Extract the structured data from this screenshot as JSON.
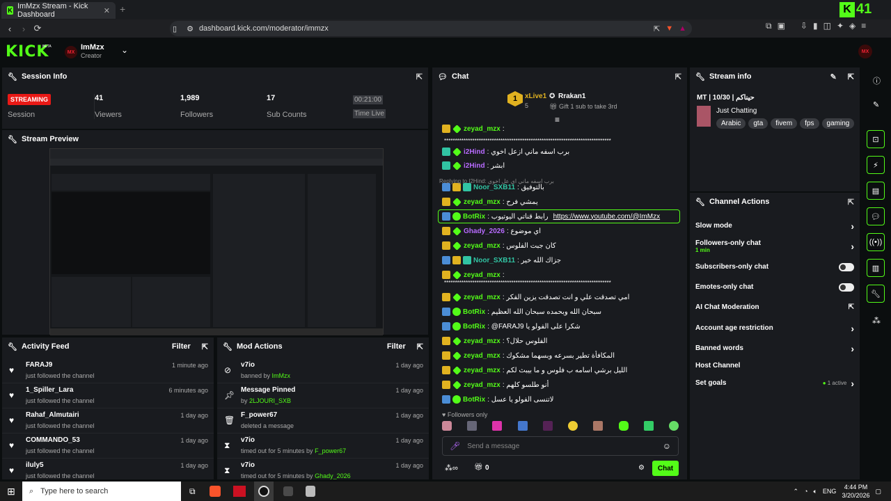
{
  "browser": {
    "tab_title": "ImMzx Stream - Kick Dashboard",
    "url": "dashboard.kick.com/moderator/immzx",
    "ext_badge": "41"
  },
  "header": {
    "logo": "KICK",
    "beta": "BETA",
    "channel": "ImMzx",
    "role": "Creator",
    "avatar": "MX"
  },
  "session": {
    "title": "Session Info",
    "status": "STREAMING",
    "status_label": "Session",
    "viewers": "41",
    "viewers_label": "Viewers",
    "followers": "1,989",
    "followers_label": "Followers",
    "subs": "17",
    "subs_label": "Sub Counts",
    "time": "00:21:00",
    "time_label": "Time Live"
  },
  "preview": {
    "title": "Stream Preview"
  },
  "activity": {
    "title": "Activity Feed",
    "filter": "Filter",
    "items": [
      {
        "name": "FARAJ9",
        "sub": "just followed the channel",
        "time": "1 minute ago"
      },
      {
        "name": "1_Spiller_Lara",
        "sub": "just followed the channel",
        "time": "6 minutes ago"
      },
      {
        "name": "Rahaf_Almutairi",
        "sub": "just followed the channel",
        "time": "1 day ago"
      },
      {
        "name": "COMMANDO_53",
        "sub": "just followed the channel",
        "time": "1 day ago"
      },
      {
        "name": "iluly5",
        "sub": "just followed the channel",
        "time": "1 day ago"
      }
    ]
  },
  "mod": {
    "title": "Mod Actions",
    "filter": "Filter",
    "items": [
      {
        "name": "v7io",
        "pre": "banned by ",
        "by": "ImMzx",
        "time": "1 day ago"
      },
      {
        "name": "Message Pinned",
        "pre": "by ",
        "by": "2LJOURI_SXB",
        "time": "1 day ago"
      },
      {
        "name": "F_power67",
        "pre": "deleted a message",
        "by": "",
        "time": "1 day ago"
      },
      {
        "name": "v7io",
        "pre": "timed out for 5 minutes by ",
        "by": "F_power67",
        "time": "1 day ago"
      },
      {
        "name": "v7io",
        "pre": "timed out for 5 minutes by ",
        "by": "Ghady_2026",
        "time": "1 day ago"
      }
    ]
  },
  "chat": {
    "title": "Chat",
    "top1_name": "xLive1",
    "top1_count": "5",
    "top2_name": "Rrakan1",
    "gift": "Gift 1 sub to take 3rd",
    "reply": "Replying to I2Hind: برب اسفه ماني اي عل اخوي",
    "lines": [
      {
        "b": "crown gem",
        "name": "zeyad_mzx",
        "c": "#53fc18",
        "msg": ":"
      },
      {
        "b": "",
        "name": "",
        "c": "#fff",
        "msg": "*****************************************************************************"
      },
      {
        "b": "sub gem",
        "name": "i2Hind",
        "c": "#b86bff",
        "msg": ": برب اسفه ماني ازعل اخوي"
      },
      {
        "b": "sub gem",
        "name": "i2Hind",
        "c": "#b86bff",
        "msg": ": ابشر"
      },
      {
        "b": "mod crown sub",
        "name": "Noor_SXB11",
        "c": "#31c4a3",
        "msg": ": بالتوفيق"
      },
      {
        "b": "crown gem",
        "name": "zeyad_mzx",
        "c": "#53fc18",
        "msg": ": يمشي فرح"
      },
      {
        "b": "mod bot",
        "name": "BotRix",
        "c": "#53fc18",
        "msg": ": رابط قناتي اليوتيوب",
        "link": "https://www.youtube.com/@ImMzx"
      },
      {
        "b": "crown gem",
        "name": "Ghady_2026",
        "c": "#b86bff",
        "msg": ": اي موضوع"
      },
      {
        "b": "crown gem",
        "name": "zeyad_mzx",
        "c": "#53fc18",
        "msg": ": كان جبت الفلوس"
      },
      {
        "b": "mod crown sub",
        "name": "Noor_SXB11",
        "c": "#31c4a3",
        "msg": ": جزاك الله خير"
      },
      {
        "b": "crown gem",
        "name": "zeyad_mzx",
        "c": "#53fc18",
        "msg": ":"
      },
      {
        "b": "",
        "name": "",
        "c": "#fff",
        "msg": "*****************************************************************************"
      },
      {
        "b": "crown gem",
        "name": "zeyad_mzx",
        "c": "#53fc18",
        "msg": ": امي تصدقت علي و انت تصدقت يزين الفكر"
      },
      {
        "b": "mod bot",
        "name": "BotRix",
        "c": "#53fc18",
        "msg": ": سبحان الله وبحمده سبحان الله العظيم"
      },
      {
        "b": "mod bot",
        "name": "BotRix",
        "c": "#53fc18",
        "msg": ": @FARAJ9 شكرا على الفولو يا"
      },
      {
        "b": "crown gem",
        "name": "zeyad_mzx",
        "c": "#53fc18",
        "msg": ": الفلوس حلال؟"
      },
      {
        "b": "crown gem",
        "name": "zeyad_mzx",
        "c": "#53fc18",
        "msg": ": المكافأة تطير بسرعه وبسهما مشكوك"
      },
      {
        "b": "crown gem",
        "name": "zeyad_mzx",
        "c": "#53fc18",
        "msg": ": الليل برشي اسامه ب فلوس و ما بيبث لكم"
      },
      {
        "b": "crown gem",
        "name": "zeyad_mzx",
        "c": "#53fc18",
        "msg": ": أنو طلسو كلهم"
      },
      {
        "b": "mod bot",
        "name": "BotRix",
        "c": "#53fc18",
        "msg": ": لاتنسى الفولو يا عسل"
      }
    ],
    "followers_only": "Followers only",
    "placeholder": "Send a message",
    "bottom_count": "0",
    "send": "Chat"
  },
  "streaminfo": {
    "title": "Stream info",
    "stream_title": "MT | 10/30 | حيناكم",
    "category": "Just Chatting",
    "tags": [
      "Arabic",
      "gta",
      "fivem",
      "fps",
      "gaming"
    ]
  },
  "actions": {
    "title": "Channel Actions",
    "slow": "Slow mode",
    "followers": "Followers-only chat",
    "followers_sub": "1 min",
    "subs": "Subscribers-only chat",
    "emotes": "Emotes-only chat",
    "ai": "AI Chat Moderation",
    "age": "Account age restriction",
    "banned": "Banned words",
    "host": "Host Channel",
    "goals": "Set goals",
    "goals_status": "1 active"
  },
  "taskbar": {
    "search": "Type here to search",
    "lang": "ENG",
    "time": "4:44 PM",
    "date": "3/20/2026"
  }
}
